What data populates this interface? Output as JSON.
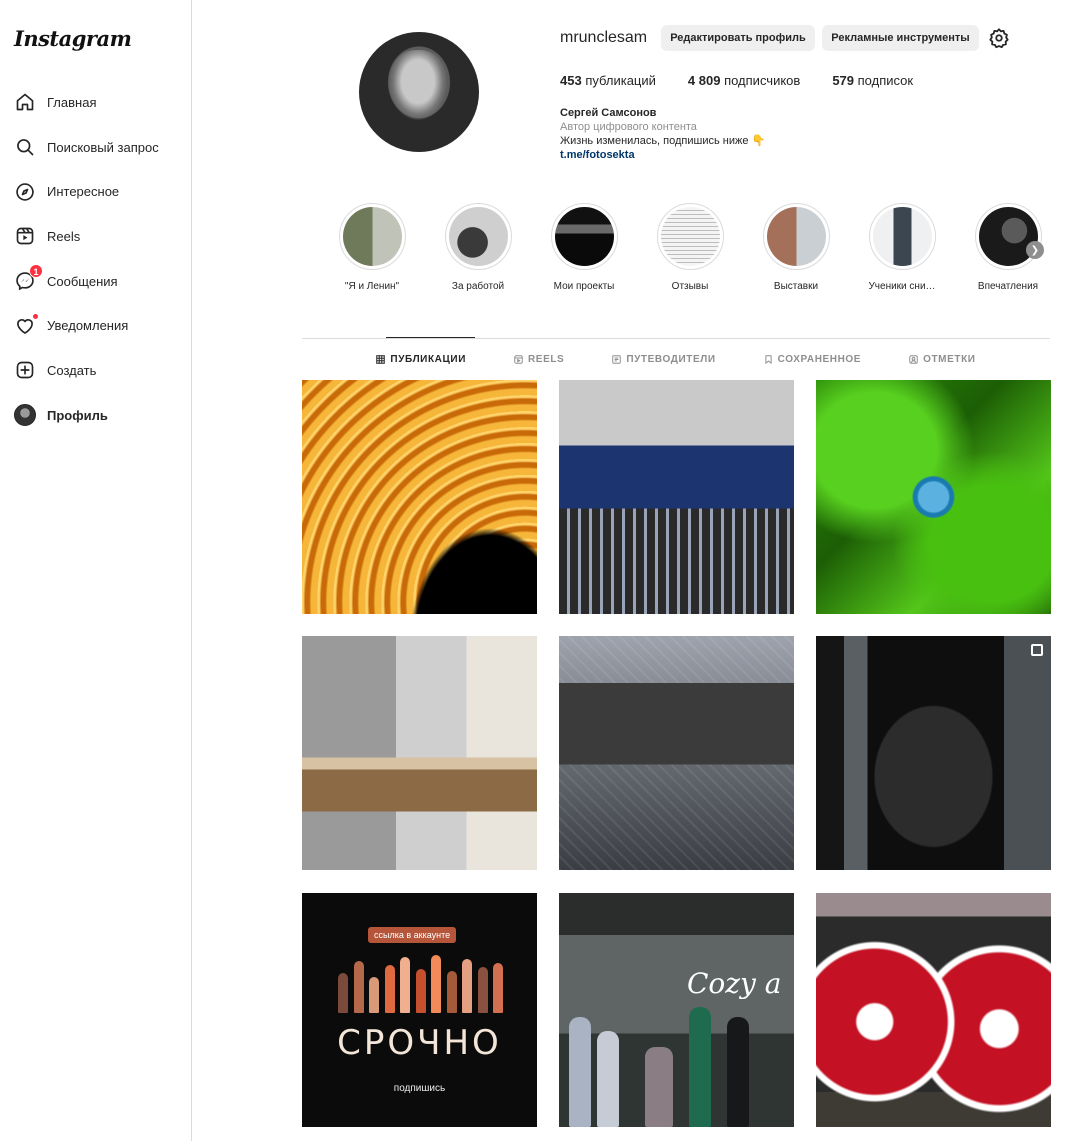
{
  "app": {
    "logo": "Instagram"
  },
  "sidebar": {
    "items": [
      {
        "label": "Главная",
        "icon": "home-icon"
      },
      {
        "label": "Поисковый запрос",
        "icon": "search-icon"
      },
      {
        "label": "Интересное",
        "icon": "compass-icon"
      },
      {
        "label": "Reels",
        "icon": "reels-icon"
      },
      {
        "label": "Сообщения",
        "icon": "messenger-icon",
        "badge": "1"
      },
      {
        "label": "Уведомления",
        "icon": "heart-icon"
      },
      {
        "label": "Создать",
        "icon": "plus-square-icon"
      },
      {
        "label": "Профиль",
        "icon": "avatar"
      }
    ]
  },
  "profile": {
    "username": "mrunclesam",
    "edit_button": "Редактировать профиль",
    "ads_button": "Рекламные инструменты",
    "stats": {
      "posts": "453",
      "posts_label": "публикаций",
      "followers": "4 809",
      "followers_label": "подписчиков",
      "following": "579",
      "following_label": "подписок"
    },
    "bio": {
      "name": "Сергей Самсонов",
      "category": "Автор цифрового контента",
      "text": "Жизнь изменилась, подпишись ниже 👇",
      "link": "t.me/fotosekta"
    }
  },
  "highlights": [
    {
      "label": "\"Я и Ленин\""
    },
    {
      "label": "За работой"
    },
    {
      "label": "Мои проекты"
    },
    {
      "label": "Отзывы"
    },
    {
      "label": "Выставки"
    },
    {
      "label": "Ученики сни…"
    },
    {
      "label": "Впечатления"
    }
  ],
  "tabs": [
    {
      "label": "ПУБЛИКАЦИИ",
      "icon": "grid-icon"
    },
    {
      "label": "REELS",
      "icon": "reels-icon"
    },
    {
      "label": "ПУТЕВОДИТЕЛИ",
      "icon": "guide-icon"
    },
    {
      "label": "СОХРАНЕННОЕ",
      "icon": "bookmark-icon"
    },
    {
      "label": "ОТМЕТКИ",
      "icon": "tag-icon"
    }
  ],
  "posts": {
    "p7": {
      "tag": "ссылка в аккаунте",
      "headline": "СРОЧНО",
      "sub": "подпишись"
    },
    "p8": {
      "sign": "Cozy a"
    }
  },
  "colors": {
    "accent": "#0095f6",
    "badge": "#ff3040",
    "link": "#00376b"
  }
}
